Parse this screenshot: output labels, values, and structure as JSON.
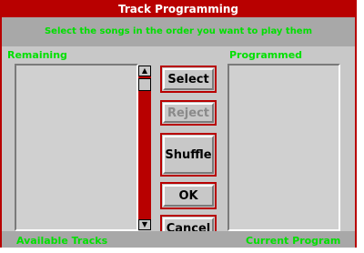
{
  "window": {
    "title": "Track Programming"
  },
  "instructions": "Select the songs in the order you want to play them",
  "remaining": {
    "label": "Remaining",
    "footer": "Available Tracks"
  },
  "programmed": {
    "label": "Programmed",
    "footer": "Current Program"
  },
  "buttons": {
    "select": "Select",
    "reject": "Reject",
    "shuffle": "Shuffle",
    "ok": "OK",
    "cancel": "Cancel"
  },
  "icons": {
    "scroll_up": "scroll-up-arrow",
    "scroll_down": "scroll-down-arrow"
  },
  "colors": {
    "accent": "#b80000",
    "label_green": "#00e000",
    "face": "#c8c8c8"
  }
}
